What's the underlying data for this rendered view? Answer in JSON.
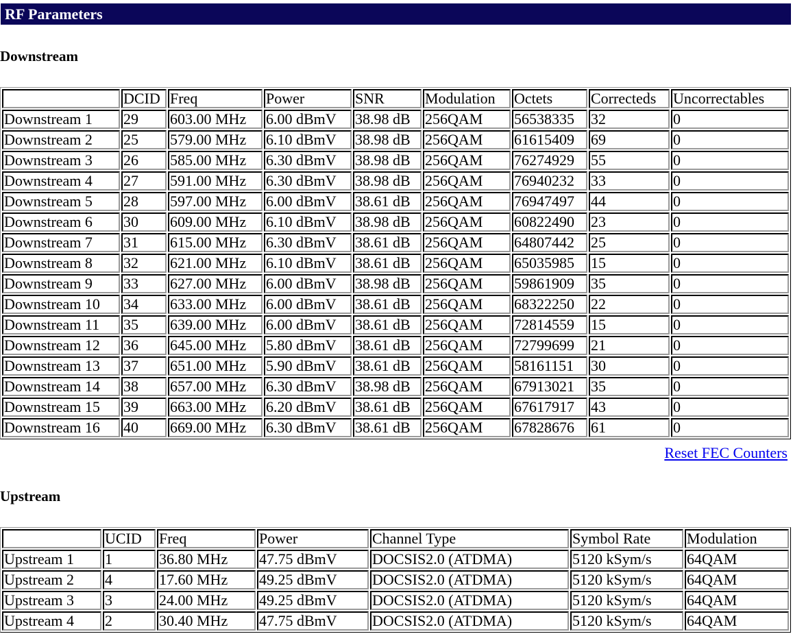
{
  "page_title": "RF Parameters",
  "downstream": {
    "heading": "Downstream",
    "columns": [
      "",
      "DCID",
      "Freq",
      "Power",
      "SNR",
      "Modulation",
      "Octets",
      "Correcteds",
      "Uncorrectables"
    ],
    "rows": [
      [
        "Downstream 1",
        "29",
        "603.00 MHz",
        "6.00 dBmV",
        "38.98 dB",
        "256QAM",
        "56538335",
        "32",
        "0"
      ],
      [
        "Downstream 2",
        "25",
        "579.00 MHz",
        "6.10 dBmV",
        "38.98 dB",
        "256QAM",
        "61615409",
        "69",
        "0"
      ],
      [
        "Downstream 3",
        "26",
        "585.00 MHz",
        "6.30 dBmV",
        "38.98 dB",
        "256QAM",
        "76274929",
        "55",
        "0"
      ],
      [
        "Downstream 4",
        "27",
        "591.00 MHz",
        "6.30 dBmV",
        "38.98 dB",
        "256QAM",
        "76940232",
        "33",
        "0"
      ],
      [
        "Downstream 5",
        "28",
        "597.00 MHz",
        "6.00 dBmV",
        "38.61 dB",
        "256QAM",
        "76947497",
        "44",
        "0"
      ],
      [
        "Downstream 6",
        "30",
        "609.00 MHz",
        "6.10 dBmV",
        "38.98 dB",
        "256QAM",
        "60822490",
        "23",
        "0"
      ],
      [
        "Downstream 7",
        "31",
        "615.00 MHz",
        "6.30 dBmV",
        "38.61 dB",
        "256QAM",
        "64807442",
        "25",
        "0"
      ],
      [
        "Downstream 8",
        "32",
        "621.00 MHz",
        "6.10 dBmV",
        "38.61 dB",
        "256QAM",
        "65035985",
        "15",
        "0"
      ],
      [
        "Downstream 9",
        "33",
        "627.00 MHz",
        "6.00 dBmV",
        "38.98 dB",
        "256QAM",
        "59861909",
        "35",
        "0"
      ],
      [
        "Downstream 10",
        "34",
        "633.00 MHz",
        "6.00 dBmV",
        "38.61 dB",
        "256QAM",
        "68322250",
        "22",
        "0"
      ],
      [
        "Downstream 11",
        "35",
        "639.00 MHz",
        "6.00 dBmV",
        "38.61 dB",
        "256QAM",
        "72814559",
        "15",
        "0"
      ],
      [
        "Downstream 12",
        "36",
        "645.00 MHz",
        "5.80 dBmV",
        "38.61 dB",
        "256QAM",
        "72799699",
        "21",
        "0"
      ],
      [
        "Downstream 13",
        "37",
        "651.00 MHz",
        "5.90 dBmV",
        "38.61 dB",
        "256QAM",
        "58161151",
        "30",
        "0"
      ],
      [
        "Downstream 14",
        "38",
        "657.00 MHz",
        "6.30 dBmV",
        "38.98 dB",
        "256QAM",
        "67913021",
        "35",
        "0"
      ],
      [
        "Downstream 15",
        "39",
        "663.00 MHz",
        "6.20 dBmV",
        "38.61 dB",
        "256QAM",
        "67617917",
        "43",
        "0"
      ],
      [
        "Downstream 16",
        "40",
        "669.00 MHz",
        "6.30 dBmV",
        "38.61 dB",
        "256QAM",
        "67828676",
        "61",
        "0"
      ]
    ],
    "reset_link": "Reset FEC Counters"
  },
  "upstream": {
    "heading": "Upstream",
    "columns": [
      "",
      "UCID",
      "Freq",
      "Power",
      "Channel Type",
      "Symbol Rate",
      "Modulation"
    ],
    "rows": [
      [
        "Upstream 1",
        "1",
        "36.80 MHz",
        "47.75 dBmV",
        "DOCSIS2.0 (ATDMA)",
        "5120 kSym/s",
        "64QAM"
      ],
      [
        "Upstream 2",
        "4",
        "17.60 MHz",
        "49.25 dBmV",
        "DOCSIS2.0 (ATDMA)",
        "5120 kSym/s",
        "64QAM"
      ],
      [
        "Upstream 3",
        "3",
        "24.00 MHz",
        "49.25 dBmV",
        "DOCSIS2.0 (ATDMA)",
        "5120 kSym/s",
        "64QAM"
      ],
      [
        "Upstream 4",
        "2",
        "30.40 MHz",
        "47.75 dBmV",
        "DOCSIS2.0 (ATDMA)",
        "5120 kSym/s",
        "64QAM"
      ]
    ]
  },
  "colors": {
    "title_bar": "#0b0659",
    "title_text": "#ffffff",
    "link": "#0000ee"
  }
}
